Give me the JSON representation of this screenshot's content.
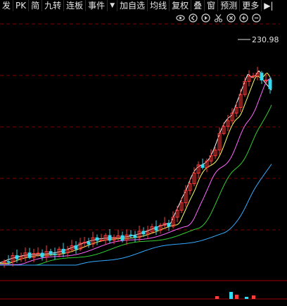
{
  "toolbar": {
    "items": [
      "发",
      "PK",
      "简",
      "九转",
      "连板",
      "事件",
      "▼",
      "加自选",
      "均线",
      "复权",
      "叠",
      "窗",
      "预测",
      "更多",
      "▶|"
    ]
  },
  "icons": [
    "eye-icon",
    "back-circle-icon",
    "play-circle-icon",
    "scissors-icon",
    "close-circle-icon",
    "zoom-in-icon",
    "zoom-out-icon"
  ],
  "chart": {
    "max_label": "230.98",
    "colors": {
      "up": "#ff3b3b",
      "down": "#35d9f0",
      "ma5": "#ffffff",
      "ma10": "#ffff66",
      "ma20": "#ff66ff",
      "ma30": "#33cc33",
      "ma60": "#33aaff",
      "grid": "#800000"
    }
  },
  "chart_data": {
    "type": "candlestick",
    "max_price": 230.98
  }
}
